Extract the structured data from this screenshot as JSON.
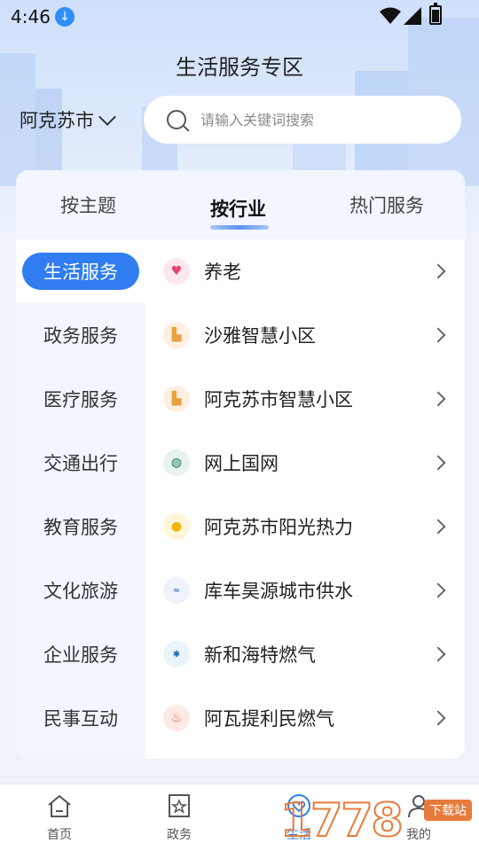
{
  "status_bar": {
    "time": "4:46"
  },
  "header": {
    "title": "生活服务专区"
  },
  "location": {
    "city": "阿克苏市"
  },
  "search": {
    "placeholder": "请输入关键词搜索"
  },
  "tabs": [
    {
      "label": "按主题"
    },
    {
      "label": "按行业"
    },
    {
      "label": "热门服务"
    }
  ],
  "sidebar": {
    "items": [
      {
        "label": "生活服务"
      },
      {
        "label": "政务服务"
      },
      {
        "label": "医疗服务"
      },
      {
        "label": "交通出行"
      },
      {
        "label": "教育服务"
      },
      {
        "label": "文化旅游"
      },
      {
        "label": "企业服务"
      },
      {
        "label": "民事互动"
      }
    ]
  },
  "services": [
    {
      "label": "养老",
      "icon": "heart-icon"
    },
    {
      "label": "沙雅智慧小区",
      "icon": "building-icon"
    },
    {
      "label": "阿克苏市智慧小区",
      "icon": "building-icon"
    },
    {
      "label": "网上国网",
      "icon": "state-grid-icon"
    },
    {
      "label": "阿克苏市阳光热力",
      "icon": "sun-icon"
    },
    {
      "label": "库车昊源城市供水",
      "icon": "water-logo-icon"
    },
    {
      "label": "新和海特燃气",
      "icon": "gas-logo-icon"
    },
    {
      "label": "阿瓦提利民燃气",
      "icon": "flame-icon"
    }
  ],
  "bottom_nav": [
    {
      "label": "首页"
    },
    {
      "label": "政务"
    },
    {
      "label": "生活"
    },
    {
      "label": "我的"
    }
  ],
  "watermark": {
    "text": "1778",
    "badge": "下载站"
  },
  "colors": {
    "accent": "#2f7df0",
    "panel_bg": "#f1f6ff"
  }
}
